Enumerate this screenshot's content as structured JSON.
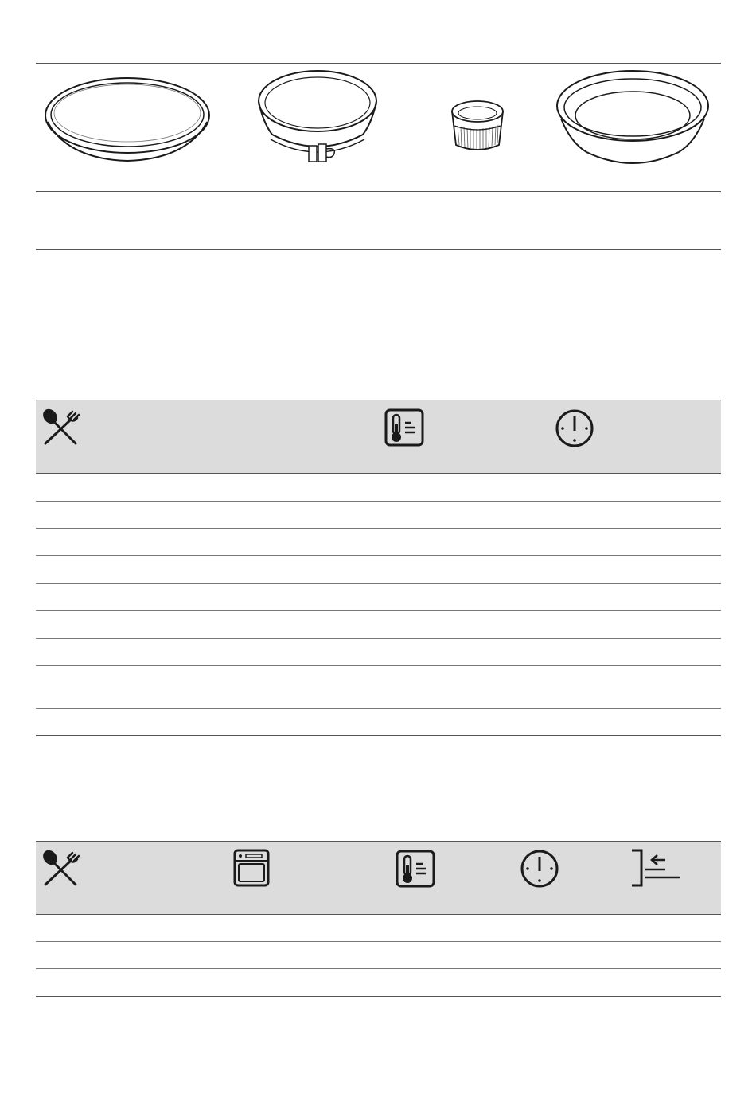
{
  "bakeware_table": {
    "items": [
      {
        "icon": "flat-tart-pan-icon"
      },
      {
        "icon": "springform-pan-icon"
      },
      {
        "icon": "ramekin-icon"
      },
      {
        "icon": "deep-pie-dish-icon"
      }
    ]
  },
  "table_1": {
    "header_icons": [
      "cutlery-icon",
      "thermometer-icon",
      "timer-icon"
    ],
    "row_count": 9
  },
  "table_2": {
    "header_icons": [
      "cutlery-icon",
      "oven-function-icon",
      "thermometer-icon",
      "timer-icon",
      "shelf-position-icon"
    ],
    "row_count": 3
  },
  "colors": {
    "header_band": "#dcdcdc",
    "rule": "#555555",
    "icon_stroke": "#1a1a1a"
  }
}
